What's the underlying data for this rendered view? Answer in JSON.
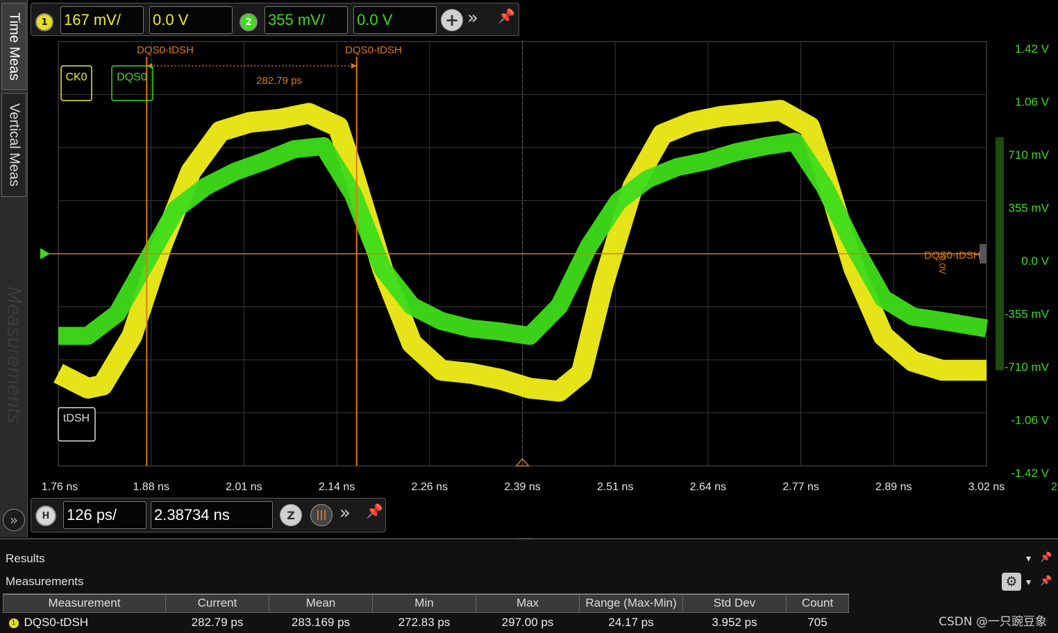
{
  "side_tabs": {
    "time_meas": "Time Meas",
    "vertical_meas": "Vertical Meas",
    "measurements_ghost": "Measurements",
    "expand_glyph": "»"
  },
  "channel_bar": {
    "ch1": {
      "number": "1",
      "scale": "167 mV/",
      "offset": "0.0 V",
      "color": "#f2ef1a"
    },
    "ch2": {
      "number": "2",
      "scale": "355 mV/",
      "offset": "0.0 V",
      "color": "#3fdc1a"
    },
    "add_glyph": "+",
    "more_glyph": "»",
    "pin_glyph": "📌"
  },
  "timebase_bar": {
    "h_label": "H",
    "scale": "126 ps/",
    "position": "2.38734 ns",
    "zoom_glyph": "Z",
    "more_glyph": "»",
    "pin_glyph": "📌"
  },
  "scope": {
    "background": "#000000",
    "grid_color": "#3a3a3a",
    "cursor_color": "#e07a10",
    "ch1_label": "CK0",
    "ch2_label": "DQS0",
    "meas_label": "tDSH",
    "cursor_a_label": "DQS0-tDSH",
    "cursor_b_label": "DQS0-tDSH",
    "delta_label": "282.79 ps",
    "right_marker_label": "DQS0-tDSH",
    "right_marker_rotated": "0.0V",
    "page_number": "2",
    "x_ticks": [
      "1.76 ns",
      "1.88 ns",
      "2.01 ns",
      "2.14 ns",
      "2.26 ns",
      "2.39 ns",
      "2.51 ns",
      "2.64 ns",
      "2.77 ns",
      "2.89 ns",
      "3.02 ns"
    ],
    "y_ticks": [
      "1.42 V",
      "1.06 V",
      "710 mV",
      "355 mV",
      "0.0 V",
      "-355 mV",
      "-710 mV",
      "-1.06 V",
      "-1.42 V"
    ]
  },
  "chart_data": {
    "type": "line",
    "xlabel": "",
    "ylabel": "",
    "xlim": [
      1.76,
      3.02
    ],
    "ylim": [
      -1.42,
      1.42
    ],
    "series": [
      {
        "name": "CK0",
        "color": "#f2ef1a",
        "x": [
          1.76,
          1.8,
          1.82,
          1.86,
          1.9,
          1.94,
          1.98,
          2.02,
          2.06,
          2.1,
          2.14,
          2.16,
          2.2,
          2.24,
          2.28,
          2.32,
          2.36,
          2.4,
          2.44,
          2.47,
          2.5,
          2.54,
          2.58,
          2.62,
          2.66,
          2.7,
          2.74,
          2.78,
          2.8,
          2.84,
          2.88,
          2.92,
          2.96,
          3.02
        ],
        "y": [
          -0.8,
          -0.9,
          -0.88,
          -0.55,
          0.05,
          0.55,
          0.82,
          0.88,
          0.9,
          0.94,
          0.85,
          0.55,
          -0.1,
          -0.6,
          -0.78,
          -0.8,
          -0.84,
          -0.9,
          -0.92,
          -0.8,
          -0.2,
          0.45,
          0.8,
          0.88,
          0.92,
          0.94,
          0.96,
          0.85,
          0.55,
          -0.1,
          -0.55,
          -0.72,
          -0.78,
          -0.78
        ]
      },
      {
        "name": "DQS0",
        "color": "#3fdc1a",
        "x": [
          1.76,
          1.8,
          1.84,
          1.88,
          1.92,
          1.96,
          2.0,
          2.04,
          2.08,
          2.12,
          2.16,
          2.2,
          2.24,
          2.28,
          2.32,
          2.36,
          2.4,
          2.44,
          2.48,
          2.52,
          2.56,
          2.6,
          2.64,
          2.68,
          2.72,
          2.76,
          2.8,
          2.84,
          2.88,
          2.92,
          2.96,
          3.02
        ],
        "y": [
          -0.55,
          -0.55,
          -0.4,
          -0.05,
          0.3,
          0.45,
          0.55,
          0.62,
          0.7,
          0.72,
          0.4,
          -0.1,
          -0.35,
          -0.45,
          -0.5,
          -0.52,
          -0.55,
          -0.35,
          0.05,
          0.35,
          0.5,
          0.58,
          0.62,
          0.68,
          0.72,
          0.75,
          0.45,
          0.05,
          -0.3,
          -0.42,
          -0.45,
          -0.5
        ]
      }
    ],
    "cursors_ns": [
      1.88,
      2.165
    ],
    "trigger_level_v": 0.0
  },
  "results": {
    "title": "Results",
    "subtitle": "Measurements",
    "controls": {
      "dropdown": "▾",
      "pin": "📌",
      "gear": "⚙"
    },
    "columns": [
      "Measurement",
      "Current",
      "Mean",
      "Min",
      "Max",
      "Range (Max-Min)",
      "Std Dev",
      "Count"
    ],
    "rows": [
      {
        "chip": "1",
        "name": "DQS0-tDSH",
        "current": "282.79 ps",
        "mean": "283.169 ps",
        "min": "272.83 ps",
        "max": "297.00 ps",
        "range": "24.17 ps",
        "stddev": "3.952 ps",
        "count": "705"
      }
    ]
  },
  "watermark": "CSDN @一只豌豆象"
}
